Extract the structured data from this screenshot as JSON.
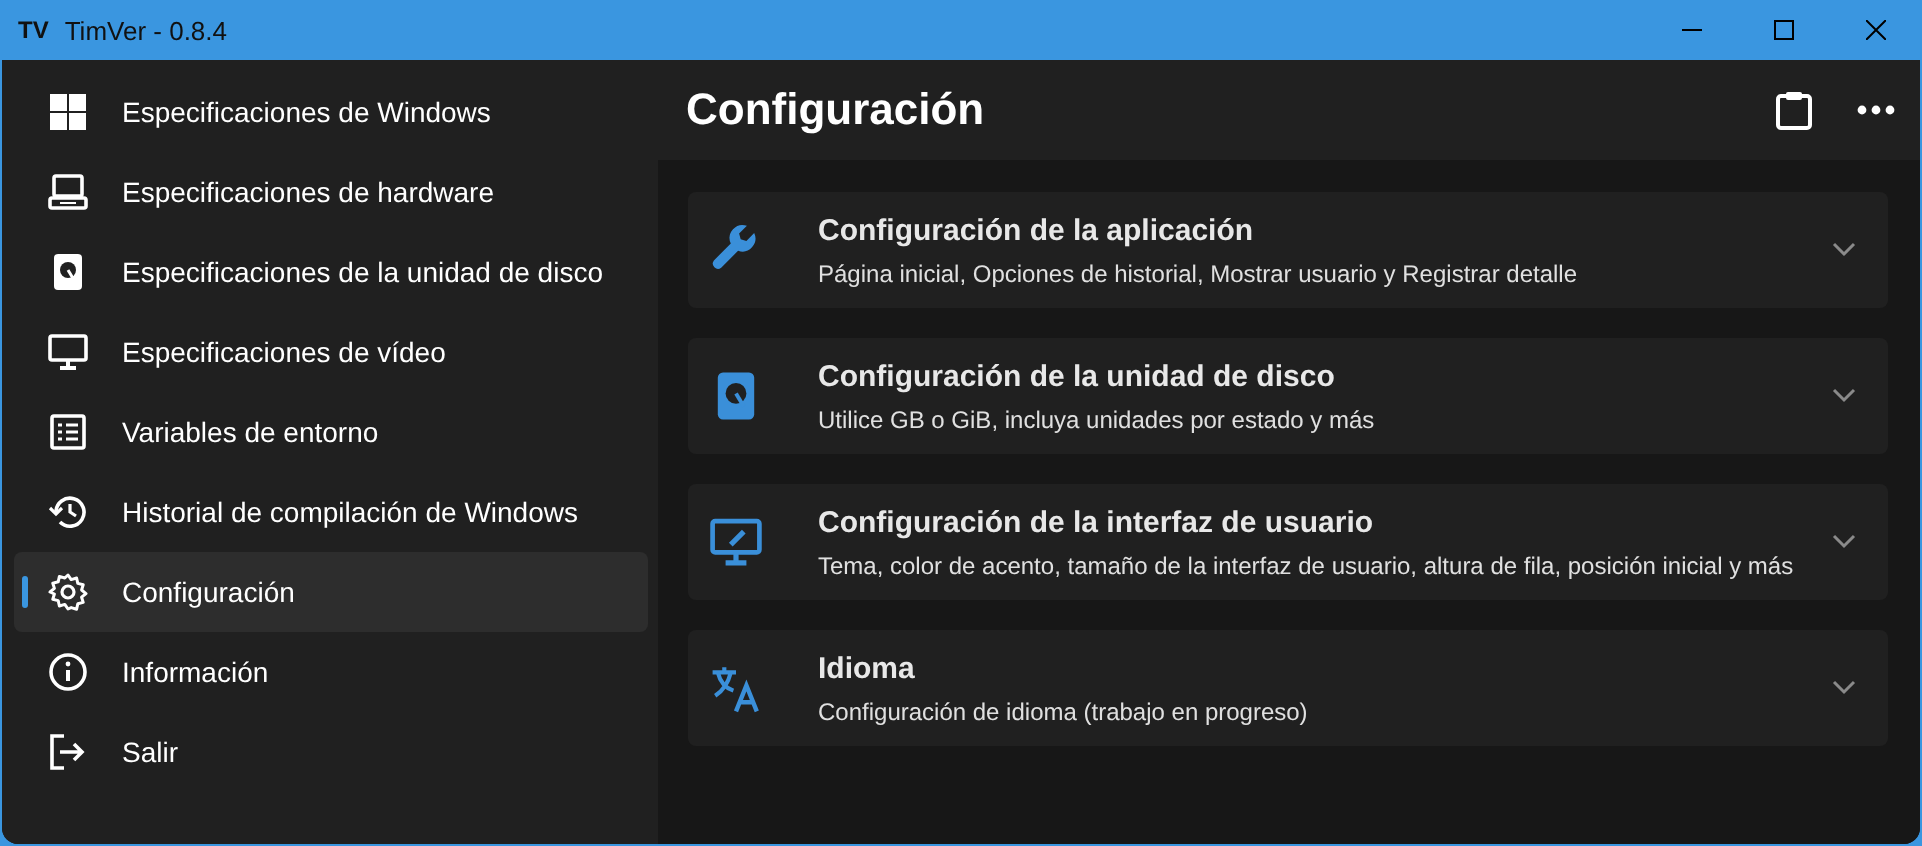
{
  "window": {
    "logo": "TV",
    "title": "TimVer - 0.8.4"
  },
  "sidebar": {
    "items": [
      {
        "label": "Especificaciones de Windows",
        "selected": false
      },
      {
        "label": "Especificaciones de hardware",
        "selected": false
      },
      {
        "label": "Especificaciones de la unidad de disco",
        "selected": false
      },
      {
        "label": "Especificaciones de vídeo",
        "selected": false
      },
      {
        "label": "Variables de entorno",
        "selected": false
      },
      {
        "label": "Historial de compilación de Windows",
        "selected": false
      },
      {
        "label": "Configuración",
        "selected": true
      },
      {
        "label": "Información",
        "selected": false
      },
      {
        "label": "Salir",
        "selected": false
      }
    ]
  },
  "page": {
    "title": "Configuración"
  },
  "sections": [
    {
      "title": "Configuración de la aplicación",
      "description": "Página inicial, Opciones de historial, Mostrar usuario y Registrar detalle",
      "expanded": false
    },
    {
      "title": "Configuración de la unidad de disco",
      "description": "Utilice GB o GiB, incluya unidades por estado y más",
      "expanded": false
    },
    {
      "title": "Configuración de la interfaz de usuario",
      "description": "Tema, color de acento, tamaño de la interfaz de usuario, altura de fila, posición inicial y más",
      "expanded": false
    },
    {
      "title": "Idioma",
      "description": "Configuración de idioma (trabajo en progreso)",
      "expanded": false
    }
  ]
}
